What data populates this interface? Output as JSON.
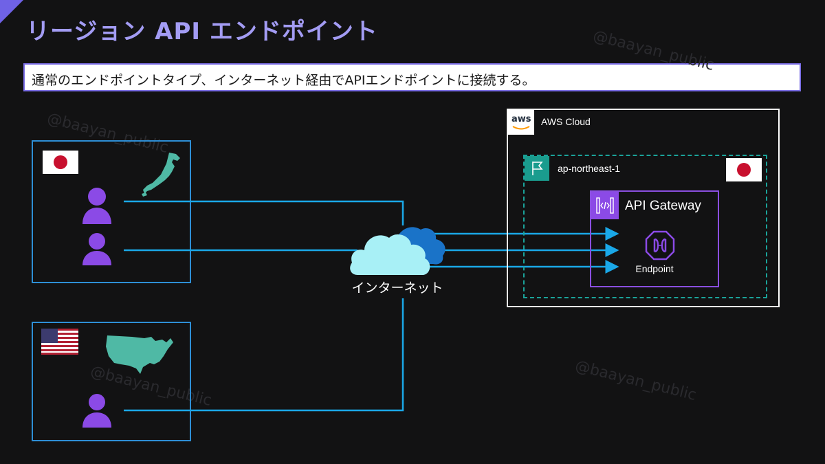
{
  "title": "リージョン API エンドポイント",
  "subtitle": "通常のエンドポイントタイプ、インターネット経由でAPIエンドポイントに接続する。",
  "watermark": "@baayan_public",
  "aws_cloud": {
    "logo_text": "aws",
    "label": "AWS Cloud"
  },
  "region": {
    "label": "ap-northeast-1"
  },
  "api_gateway": {
    "label": "API Gateway",
    "endpoint_label": "Endpoint"
  },
  "internet": {
    "label": "インターネット"
  },
  "colors": {
    "accent": "#7b6ee6",
    "title": "#a39cf4",
    "connector": "#1aa8e8",
    "user": "#8b4ae6",
    "region_border": "#1aa39a",
    "map": "#4fb9a5"
  },
  "icons": {
    "user": "user-icon",
    "cloud": "cloud-icon",
    "endpoint": "endpoint-icon",
    "region_flag": "flag-icon",
    "api_gateway": "api-gateway-icon"
  }
}
